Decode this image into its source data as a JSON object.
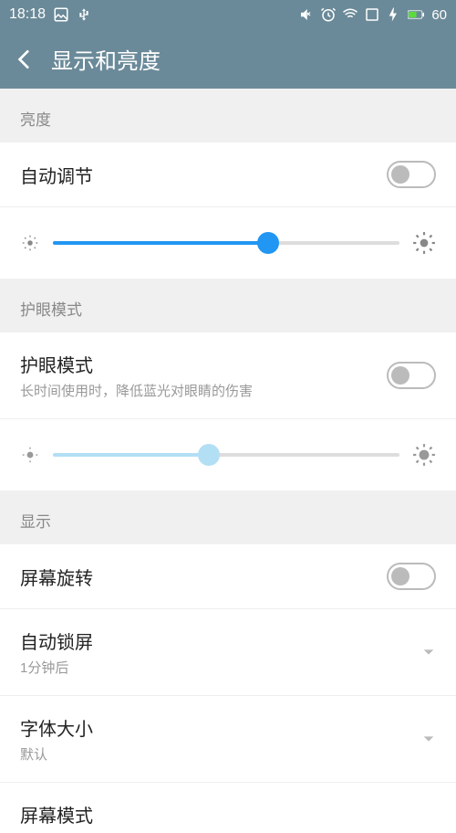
{
  "status": {
    "time": "18:18",
    "battery": "60"
  },
  "header": {
    "title": "显示和亮度"
  },
  "sections": {
    "brightness": {
      "header": "亮度",
      "auto": "自动调节"
    },
    "eyecare": {
      "header": "护眼模式",
      "title": "护眼模式",
      "desc": "长时间使用时，降低蓝光对眼睛的伤害"
    },
    "display": {
      "header": "显示",
      "rotation": "屏幕旋转",
      "autolock": {
        "title": "自动锁屏",
        "value": "1分钟后"
      },
      "fontsize": {
        "title": "字体大小",
        "value": "默认"
      },
      "screenmode": "屏幕模式"
    }
  },
  "sliders": {
    "brightness": 62,
    "eyecare": 45
  }
}
